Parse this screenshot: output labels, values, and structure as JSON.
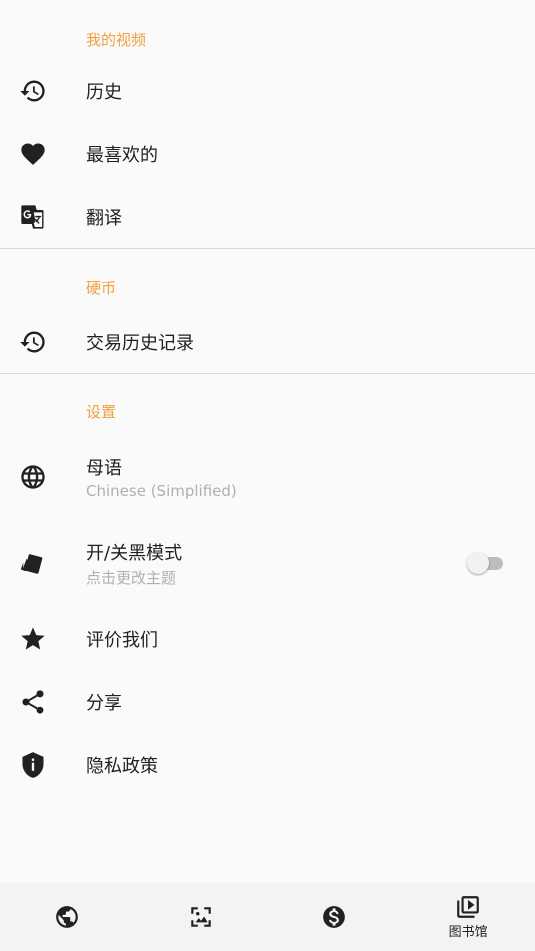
{
  "sections": {
    "my_videos": {
      "header": "我的视频",
      "items": [
        {
          "label": "历史",
          "icon": "history-icon"
        },
        {
          "label": "最喜欢的",
          "icon": "heart-icon"
        },
        {
          "label": "翻译",
          "icon": "translate-icon"
        }
      ]
    },
    "coins": {
      "header": "硬币",
      "items": [
        {
          "label": "交易历史记录",
          "icon": "history-icon"
        }
      ]
    },
    "settings": {
      "header": "设置",
      "items": [
        {
          "label": "母语",
          "sub": "Chinese (Simplified)",
          "icon": "globe-icon"
        },
        {
          "label": "开/关黑模式",
          "sub": "点击更改主题",
          "icon": "theme-cards-icon",
          "toggle_on": false
        },
        {
          "label": "评价我们",
          "icon": "star-icon"
        },
        {
          "label": "分享",
          "icon": "share-icon"
        },
        {
          "label": "隐私政策",
          "icon": "shield-info-icon"
        }
      ]
    }
  },
  "bottom_nav": {
    "tabs": [
      {
        "icon": "globe-icon",
        "label": ""
      },
      {
        "icon": "image-frame-icon",
        "label": ""
      },
      {
        "icon": "dollar-circle-icon",
        "label": ""
      },
      {
        "icon": "video-library-icon",
        "label": "图书馆",
        "active": true
      }
    ]
  },
  "colors": {
    "accent": "#f0a040",
    "background": "#fafafa",
    "text": "#212121",
    "secondary_text": "#b0b0b0"
  }
}
